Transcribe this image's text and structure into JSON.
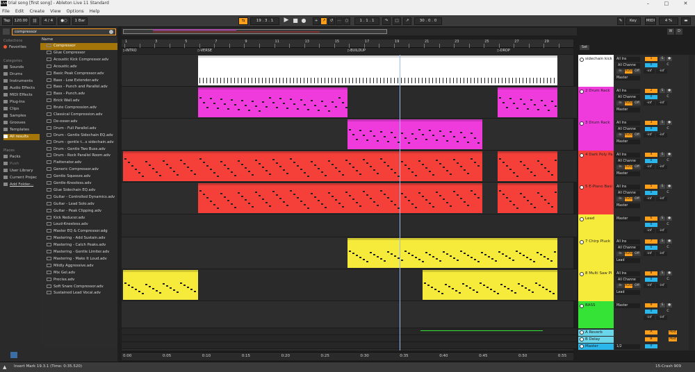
{
  "window": {
    "title": "trial song  [first song] - Ableton Live 11 Standard",
    "logo": "Live"
  },
  "menu": [
    "File",
    "Edit",
    "Create",
    "View",
    "Options",
    "Help"
  ],
  "transport": {
    "tap": "Tap",
    "tempo": "120.00",
    "signature": "4 / 4",
    "metro": "1 Bar",
    "position": "19 .  3 .  1",
    "loop_start": "1 .  1 .  1",
    "loop_length": "30 .  0 .  0",
    "key": "Key",
    "midi": "MIDI",
    "cpu": "4 %",
    "w": "W",
    "d": "D"
  },
  "browser": {
    "search_value": "compressor",
    "collections_header": "Collections",
    "favorites": "Favorites",
    "categories_header": "Categories",
    "categories": [
      "Sounds",
      "Drums",
      "Instruments",
      "Audio Effects",
      "MIDI Effects",
      "Plug-Ins",
      "Clips",
      "Samples",
      "Grooves",
      "Templates",
      "All results"
    ],
    "places_header": "Places",
    "places": [
      "Packs",
      "Push",
      "User Library",
      "Current Projec",
      "Add Folder..."
    ],
    "column_header": "Name",
    "files": [
      "Compressor",
      "Glue Compressor",
      "Acoustic Kick Compressor.adv",
      "Acoustic.adv",
      "Basic Peak Compressor.adv",
      "Bass - Low Extender.adv",
      "Bass - Punch and Parallel.adv",
      "Bass - Punch.adv",
      "Brick Wall.adv",
      "Brute Compression.adv",
      "Classical Compression.adv",
      "De-esser.adv",
      "Drum - Full Parallel.adv",
      "Drum - Gentle Sidechain EQ.adv",
      "Drum - gentle t...s sidechain.adv",
      "Drum - Gentle Two Buss.adv",
      "Drum - Rock Parallel Room.adv",
      "Flattenator.adv",
      "Generic Compressor.adv",
      "Gentle Squeeze.adv",
      "Gentle-Kneeless.adv",
      "Glue Sidechain EQ.adv",
      "Guitar - Controlled Dynamics.adv",
      "Guitar - Lead Solo.adv",
      "Guitar - Peak Clipping.adv",
      "Kick Reducer.adv",
      "Loud-Kneeless.adv",
      "Master EQ & Compressor.adg",
      "Mastering - Add Sustain.adv",
      "Mastering - Catch Peaks.adv",
      "Mastering - Gentle Limiter.adv",
      "Mastering - Make It Loud.adv",
      "Mildly Aggressive.adv",
      "Mix Gel.adv",
      "Precise.adv",
      "Soft Snare Compressor.adv",
      "Sustained Lead Vocal.adv"
    ]
  },
  "ruler": {
    "bars": [
      "1",
      "3",
      "5",
      "7",
      "9",
      "11",
      "13",
      "15",
      "17",
      "19",
      "21",
      "23",
      "25",
      "27",
      "29"
    ],
    "set": "Set"
  },
  "locators": [
    "INTRO",
    "VERSE",
    "BUILDUP",
    "DROP"
  ],
  "time": [
    "0:00",
    "0:05",
    "0:10",
    "0:15",
    "0:20",
    "0:25",
    "0:30",
    "0:35",
    "0:40",
    "0:45",
    "0:50",
    "0:55"
  ],
  "tracks": [
    {
      "name": "sidechain kick",
      "color": "#ffffff",
      "input": "All Ins",
      "channel": "All Channe",
      "monitor": [
        "In",
        "Auto",
        "Off"
      ],
      "out": "Master",
      "num": "1",
      "vol": "0",
      "pan": "C",
      "send_a": "-inf",
      "send_b": "-inf"
    },
    {
      "name": "2 Drum Rack",
      "color": "#ef3bdc",
      "input": "All Ins",
      "channel": "All Channe",
      "monitor": [
        "In",
        "Auto",
        "Off"
      ],
      "out": "Master",
      "num": "2",
      "vol": "0",
      "pan": "C",
      "send_a": "-inf",
      "send_b": "-inf"
    },
    {
      "name": "3 Drum Rack",
      "color": "#ef3bdc",
      "input": "All Ins",
      "channel": "All Channe",
      "monitor": [
        "In",
        "Auto",
        "Off"
      ],
      "out": "Master",
      "num": "3",
      "vol": "0",
      "pan": "C",
      "send_a": "-inf",
      "send_b": "-inf"
    },
    {
      "name": "4 Dark Poly Pa",
      "color": "#f5403a",
      "input": "All Ins",
      "channel": "All Channe",
      "monitor": [
        "In",
        "Auto",
        "Off"
      ],
      "out": "Master",
      "num": "4",
      "vol": "0",
      "pan": "C",
      "send_a": "-inf",
      "send_b": "-inf"
    },
    {
      "name": "5 E-Piano Basi",
      "color": "#f5403a",
      "input": "All Ins",
      "channel": "All Channe",
      "monitor": [
        "In",
        "Auto",
        "Off"
      ],
      "out": "Master",
      "num": "5",
      "vol": "0",
      "pan": "C",
      "send_a": "-inf",
      "send_b": "-inf"
    },
    {
      "name": "Lead",
      "color": "#f6ea3a",
      "out": "Master",
      "num": "6",
      "vol": "0",
      "pan": "C",
      "send_a": "-inf",
      "send_b": "-inf"
    },
    {
      "name": "7 Chirp Pluck",
      "color": "#f6ea3a",
      "input": "All Ins",
      "channel": "All Channe",
      "monitor": [
        "In",
        "Auto",
        "Off"
      ],
      "out": "Lead",
      "num": "7",
      "vol": "0",
      "pan": "C",
      "send_a": "-inf",
      "send_b": "-inf"
    },
    {
      "name": "8 Multi Saw Pl",
      "color": "#f6ea3a",
      "input": "All Ins",
      "channel": "All Channe",
      "monitor": [
        "In",
        "Auto",
        "Off"
      ],
      "out": "Lead",
      "num": "8",
      "vol": "0",
      "pan": "C",
      "send_a": "-inf",
      "send_b": "-inf"
    },
    {
      "name": "BASS",
      "color": "#35e336",
      "out": "Master",
      "num": "9",
      "vol": "0",
      "pan": "C",
      "send_a": "-inf",
      "send_b": "-inf"
    }
  ],
  "returns": [
    {
      "name": "A Reverb",
      "color": "#6ad6ea",
      "letter": "A",
      "post": "Post"
    },
    {
      "name": "B Delay",
      "color": "#6ad6ea",
      "letter": "B",
      "post": "Post"
    },
    {
      "name": "Master",
      "color": "#2ab6ea",
      "out": "1/2",
      "vol": "0"
    }
  ],
  "status": {
    "text": "Insert Mark 19.3.1 (Time: 0:35.520)",
    "device": "15-Crash 909"
  },
  "colors": {
    "accent": "#ff9f1a",
    "selected": "#a47508",
    "pink": "#ef3bdc",
    "red": "#f5403a",
    "yellow": "#f6ea3a",
    "green": "#35e336",
    "cyan": "#6ad6ea",
    "blue": "#2ab6ea"
  }
}
